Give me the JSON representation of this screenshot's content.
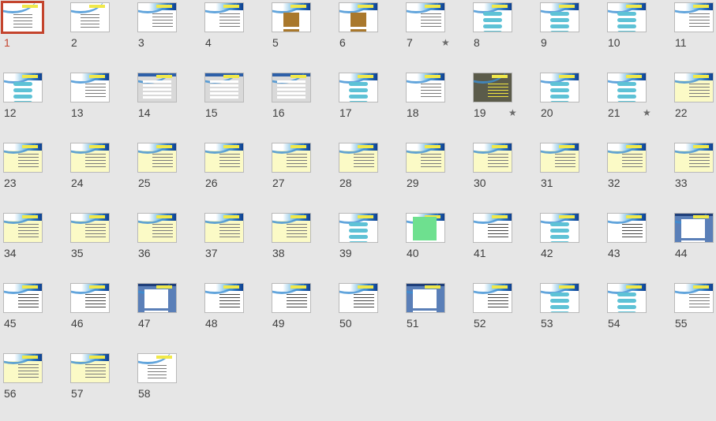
{
  "sorter": {
    "selected_slide": 1,
    "slides": [
      {
        "number": "1",
        "kind": "cover",
        "star": false
      },
      {
        "number": "2",
        "kind": "cover",
        "star": false
      },
      {
        "number": "3",
        "kind": "plain",
        "star": false
      },
      {
        "number": "4",
        "kind": "plain",
        "star": false
      },
      {
        "number": "5",
        "kind": "photo",
        "star": false
      },
      {
        "number": "6",
        "kind": "photo",
        "star": false
      },
      {
        "number": "7",
        "kind": "plain",
        "star": true
      },
      {
        "number": "8",
        "kind": "diagram",
        "star": false
      },
      {
        "number": "9",
        "kind": "diagram",
        "star": false
      },
      {
        "number": "10",
        "kind": "diagram",
        "star": false
      },
      {
        "number": "11",
        "kind": "plain",
        "star": false
      },
      {
        "number": "12",
        "kind": "diagram",
        "star": false
      },
      {
        "number": "13",
        "kind": "plain",
        "star": false
      },
      {
        "number": "14",
        "kind": "screenshot",
        "star": false
      },
      {
        "number": "15",
        "kind": "screenshot",
        "star": false
      },
      {
        "number": "16",
        "kind": "screenshot",
        "star": false
      },
      {
        "number": "17",
        "kind": "diagram",
        "star": false
      },
      {
        "number": "18",
        "kind": "plain",
        "star": false
      },
      {
        "number": "19",
        "kind": "dark",
        "star": true
      },
      {
        "number": "20",
        "kind": "diagram",
        "star": false
      },
      {
        "number": "21",
        "kind": "diagram",
        "star": true
      },
      {
        "number": "22",
        "kind": "yellow",
        "star": false
      },
      {
        "number": "23",
        "kind": "yellow",
        "star": false
      },
      {
        "number": "24",
        "kind": "yellow",
        "star": false
      },
      {
        "number": "25",
        "kind": "yellow",
        "star": false
      },
      {
        "number": "26",
        "kind": "yellow",
        "star": false
      },
      {
        "number": "27",
        "kind": "yellow",
        "star": false
      },
      {
        "number": "28",
        "kind": "yellow",
        "star": false
      },
      {
        "number": "29",
        "kind": "yellow",
        "star": false
      },
      {
        "number": "30",
        "kind": "yellow",
        "star": false
      },
      {
        "number": "31",
        "kind": "yellow",
        "star": false
      },
      {
        "number": "32",
        "kind": "yellow",
        "star": false
      },
      {
        "number": "33",
        "kind": "yellow",
        "star": false
      },
      {
        "number": "34",
        "kind": "yellow",
        "star": false
      },
      {
        "number": "35",
        "kind": "yellow",
        "star": false
      },
      {
        "number": "36",
        "kind": "yellow",
        "star": false
      },
      {
        "number": "37",
        "kind": "yellow",
        "star": false
      },
      {
        "number": "38",
        "kind": "yellow",
        "star": false
      },
      {
        "number": "39",
        "kind": "diagram",
        "star": false
      },
      {
        "number": "40",
        "kind": "green",
        "star": false
      },
      {
        "number": "41",
        "kind": "figure",
        "star": false
      },
      {
        "number": "42",
        "kind": "diagram",
        "star": false
      },
      {
        "number": "43",
        "kind": "figure",
        "star": false
      },
      {
        "number": "44",
        "kind": "blue",
        "star": false
      },
      {
        "number": "45",
        "kind": "figure",
        "star": false
      },
      {
        "number": "46",
        "kind": "figure",
        "star": false
      },
      {
        "number": "47",
        "kind": "blue",
        "star": false
      },
      {
        "number": "48",
        "kind": "figure",
        "star": false
      },
      {
        "number": "49",
        "kind": "figure",
        "star": false
      },
      {
        "number": "50",
        "kind": "figure",
        "star": false
      },
      {
        "number": "51",
        "kind": "blue",
        "star": false
      },
      {
        "number": "52",
        "kind": "figure",
        "star": false
      },
      {
        "number": "53",
        "kind": "diagram",
        "star": false
      },
      {
        "number": "54",
        "kind": "diagram",
        "star": false
      },
      {
        "number": "55",
        "kind": "plain",
        "star": false
      },
      {
        "number": "56",
        "kind": "yellow",
        "star": false
      },
      {
        "number": "57",
        "kind": "yellow",
        "star": false
      },
      {
        "number": "58",
        "kind": "cover",
        "star": false
      }
    ],
    "colors": {
      "background": "#e6e6e6",
      "selection": "#c4442d",
      "number_text": "#404040"
    },
    "icons": {
      "star": "animation-star-icon"
    }
  }
}
